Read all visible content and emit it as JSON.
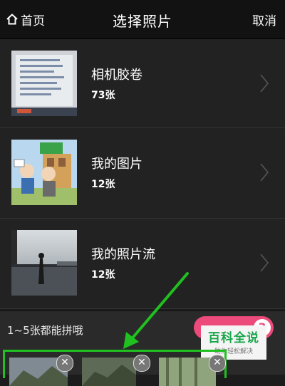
{
  "nav": {
    "home_label": "首页",
    "title": "选择照片",
    "cancel_label": "取消"
  },
  "albums": [
    {
      "name": "相机胶卷",
      "count": "73张"
    },
    {
      "name": "我的图片",
      "count": "12张"
    },
    {
      "name": "我的照片流",
      "count": "12张"
    }
  ],
  "footer": {
    "hint": "1~5张都能拼哦",
    "selected_count": "3"
  },
  "watermark": {
    "title": "百科全说",
    "subtitle": "助你轻松解决"
  },
  "colors": {
    "accent_pink": "#ec4a7a",
    "highlight_green": "#1fc01f",
    "watermark_green": "#19a64b"
  },
  "icons": [
    "home-icon",
    "chevron-right-icon",
    "remove-icon",
    "arrow-annotation"
  ]
}
